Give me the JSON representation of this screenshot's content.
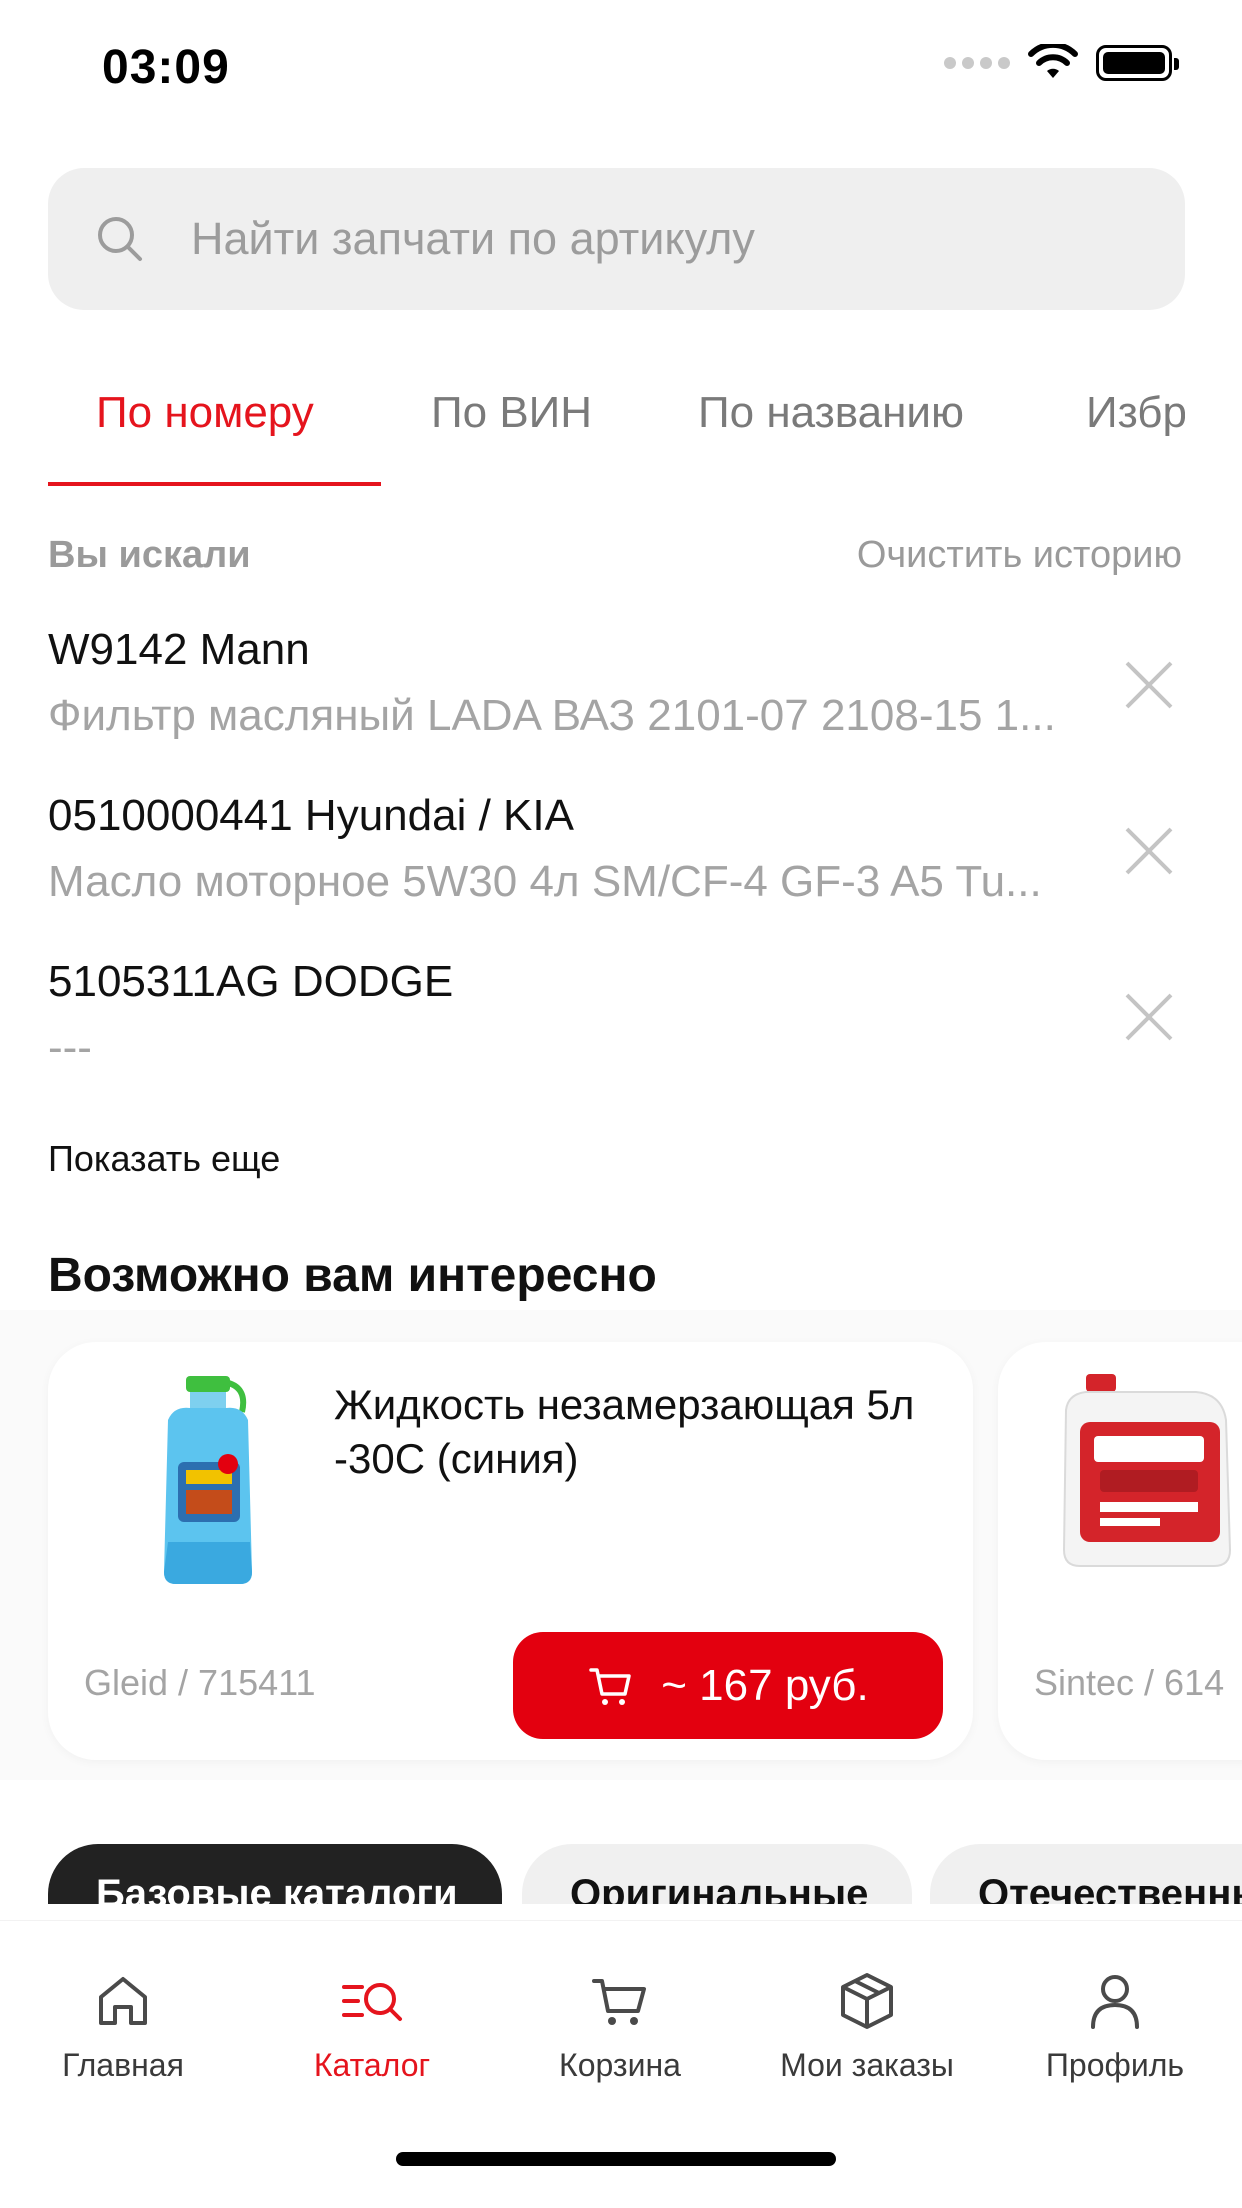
{
  "status": {
    "time": "03:09"
  },
  "search": {
    "placeholder": "Найти запчати по артикулу"
  },
  "tabs": [
    {
      "label": "По номеру",
      "active": true
    },
    {
      "label": "По ВИН",
      "active": false
    },
    {
      "label": "По названию",
      "active": false
    },
    {
      "label": "Избр",
      "active": false
    }
  ],
  "history": {
    "title": "Вы искали",
    "clear_label": "Очистить историю",
    "items": [
      {
        "main": "W9142 Mann",
        "sub": "Фильтр масляный LADA ВАЗ 2101-07 2108-15 1..."
      },
      {
        "main": "0510000441 Hyundai / KIA",
        "sub": "Масло моторное 5W30 4л SM/CF-4 GF-3 A5 Tu..."
      },
      {
        "main": "5105311AG DODGE",
        "sub": "---"
      }
    ],
    "show_more": "Показать еще"
  },
  "recommend": {
    "title": "Возможно вам интересно",
    "products": [
      {
        "title": "Жидкость незамерзающая 5л -30С (синия)",
        "brand": "Gleid / 715411",
        "price": "~ 167 руб."
      },
      {
        "title": "",
        "brand": "Sintec / 614",
        "price": ""
      }
    ]
  },
  "catalogs": [
    "Базовые каталоги",
    "Оригинальные",
    "Отечественны"
  ],
  "nav": [
    {
      "label": "Главная",
      "icon": "home-icon",
      "active": false
    },
    {
      "label": "Каталог",
      "icon": "catalog-search-icon",
      "active": true
    },
    {
      "label": "Корзина",
      "icon": "cart-icon",
      "active": false
    },
    {
      "label": "Мои заказы",
      "icon": "box-icon",
      "active": false
    },
    {
      "label": "Профиль",
      "icon": "user-icon",
      "active": false
    }
  ],
  "colors": {
    "accent": "#e5141d",
    "price_button": "#e3000f",
    "muted_text": "#a4a4a4",
    "search_bg": "#efefef"
  }
}
